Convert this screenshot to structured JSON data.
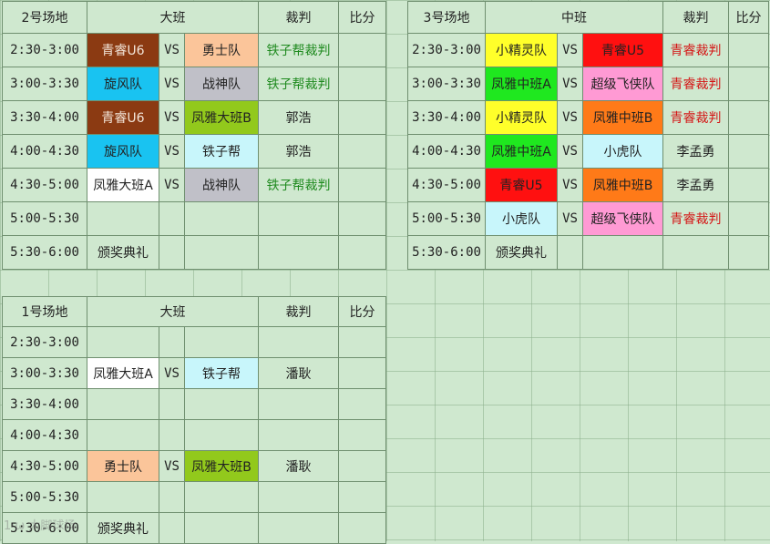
{
  "colors": {
    "brown": "#8b3a12",
    "cyan": "#19c3f1",
    "peach": "#fbc59a",
    "gray": "#c0c0c8",
    "olive": "#92c91c",
    "lightcyan": "#c8f6fb",
    "white": "#ffffff",
    "yellow": "#ffff2a",
    "red": "#ff1010",
    "green": "#1fe81f",
    "pink": "#ff9ad4",
    "orange": "#ff7a18"
  },
  "vs": "VS",
  "table2": {
    "header": {
      "field": "2号场地",
      "class": "大班",
      "referee": "裁判",
      "score": "比分"
    },
    "rows": [
      {
        "time": "2:30-3:00",
        "teamA": "青睿U6",
        "teamB": "勇士队",
        "referee": "铁子帮裁判",
        "ref_color": "green",
        "colorA": "brown",
        "colorB": "peach"
      },
      {
        "time": "3:00-3:30",
        "teamA": "旋风队",
        "teamB": "战神队",
        "referee": "铁子帮裁判",
        "ref_color": "green",
        "colorA": "cyan",
        "colorB": "gray"
      },
      {
        "time": "3:30-4:00",
        "teamA": "青睿U6",
        "teamB": "凤雅大班B",
        "referee": "郭浩",
        "ref_color": "dark",
        "colorA": "brown",
        "colorB": "olive"
      },
      {
        "time": "4:00-4:30",
        "teamA": "旋风队",
        "teamB": "铁子帮",
        "referee": "郭浩",
        "ref_color": "dark",
        "colorA": "cyan",
        "colorB": "lightcyan"
      },
      {
        "time": "4:30-5:00",
        "teamA": "凤雅大班A",
        "teamB": "战神队",
        "referee": "铁子帮裁判",
        "ref_color": "green",
        "colorA": "white",
        "colorB": "gray"
      },
      {
        "time": "5:00-5:30"
      },
      {
        "time": "5:30-6:00",
        "ceremony": "颁奖典礼"
      }
    ]
  },
  "table3": {
    "header": {
      "field": "3号场地",
      "class": "中班",
      "referee": "裁判",
      "score": "比分"
    },
    "rows": [
      {
        "time": "2:30-3:00",
        "teamA": "小精灵队",
        "teamB": "青睿U5",
        "referee": "青睿裁判",
        "ref_color": "red",
        "colorA": "yellow",
        "colorB": "red"
      },
      {
        "time": "3:00-3:30",
        "teamA": "凤雅中班A",
        "teamB": "超级飞侠队",
        "referee": "青睿裁判",
        "ref_color": "red",
        "colorA": "green",
        "colorB": "pink"
      },
      {
        "time": "3:30-4:00",
        "teamA": "小精灵队",
        "teamB": "凤雅中班B",
        "referee": "青睿裁判",
        "ref_color": "red",
        "colorA": "yellow",
        "colorB": "orange"
      },
      {
        "time": "4:00-4:30",
        "teamA": "凤雅中班A",
        "teamB": "小虎队",
        "referee": "李孟勇",
        "ref_color": "dark",
        "colorA": "green",
        "colorB": "lightcyan"
      },
      {
        "time": "4:30-5:00",
        "teamA": "青睿U5",
        "teamB": "凤雅中班B",
        "referee": "李孟勇",
        "ref_color": "dark",
        "colorA": "red",
        "colorB": "orange"
      },
      {
        "time": "5:00-5:30",
        "teamA": "小虎队",
        "teamB": "超级飞侠队",
        "referee": "青睿裁判",
        "ref_color": "red",
        "colorA": "lightcyan",
        "colorB": "pink"
      },
      {
        "time": "5:30-6:00",
        "ceremony": "颁奖典礼"
      }
    ]
  },
  "table1": {
    "header": {
      "field": "1号场地",
      "class": "大班",
      "referee": "裁判",
      "score": "比分"
    },
    "rows": [
      {
        "time": "2:30-3:00"
      },
      {
        "time": "3:00-3:30",
        "teamA": "凤雅大班A",
        "teamB": "铁子帮",
        "referee": "潘耿",
        "ref_color": "dark",
        "colorA": "white",
        "colorB": "lightcyan"
      },
      {
        "time": "3:30-4:00"
      },
      {
        "time": "4:00-4:30"
      },
      {
        "time": "4:30-5:00",
        "teamA": "勇士队",
        "teamB": "凤雅大班B",
        "referee": "潘耿",
        "ref_color": "dark",
        "colorA": "peach",
        "colorB": "olive"
      },
      {
        "time": "5:00-5:30"
      },
      {
        "time": "5:30-6:00",
        "ceremony": "颁奖典礼"
      }
    ]
  },
  "watermark": "1·ω 大脚球场"
}
